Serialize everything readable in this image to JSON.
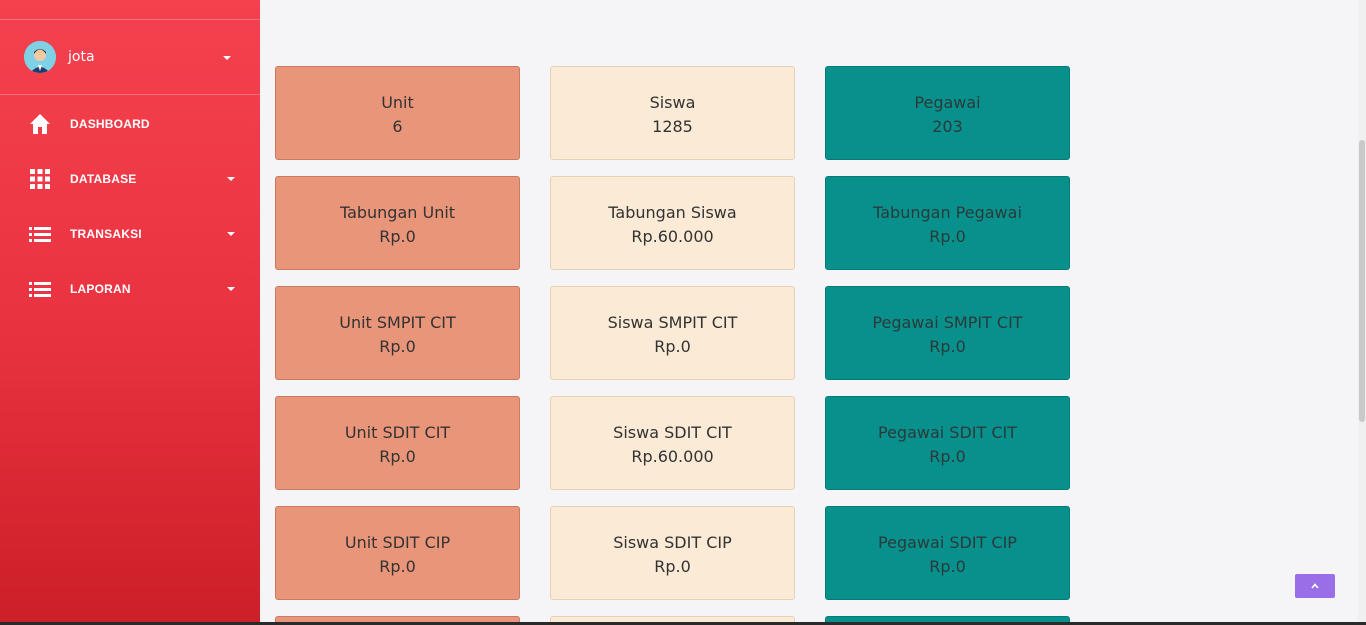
{
  "user": {
    "name": "jota"
  },
  "sidebar": {
    "items": [
      {
        "label": "DASHBOARD",
        "icon": "home-icon"
      },
      {
        "label": "DATABASE",
        "icon": "grid-icon"
      },
      {
        "label": "TRANSAKSI",
        "icon": "list-icon"
      },
      {
        "label": "LAPORAN",
        "icon": "list-icon"
      }
    ]
  },
  "cards": {
    "unit": [
      {
        "label": "Unit",
        "value": "6"
      },
      {
        "label": "Tabungan Unit",
        "value": "Rp.0"
      },
      {
        "label": "Unit SMPIT CIT",
        "value": "Rp.0"
      },
      {
        "label": "Unit SDIT CIT",
        "value": "Rp.0"
      },
      {
        "label": "Unit SDIT CIP",
        "value": "Rp.0"
      }
    ],
    "siswa": [
      {
        "label": "Siswa",
        "value": "1285"
      },
      {
        "label": "Tabungan Siswa",
        "value": "Rp.60.000"
      },
      {
        "label": "Siswa SMPIT CIT",
        "value": "Rp.0"
      },
      {
        "label": "Siswa SDIT CIT",
        "value": "Rp.60.000"
      },
      {
        "label": "Siswa SDIT CIP",
        "value": "Rp.0"
      }
    ],
    "pegawai": [
      {
        "label": "Pegawai",
        "value": "203"
      },
      {
        "label": "Tabungan Pegawai",
        "value": "Rp.0"
      },
      {
        "label": "Pegawai SMPIT CIT",
        "value": "Rp.0"
      },
      {
        "label": "Pegawai SDIT CIT",
        "value": "Rp.0"
      },
      {
        "label": "Pegawai SDIT CIP",
        "value": "Rp.0"
      }
    ]
  },
  "colors": {
    "sidebar_top": "#f5414f",
    "sidebar_bottom": "#cc1f28",
    "unit_card": "#e9957a",
    "siswa_card": "#fbead5",
    "pegawai_card": "#08918c",
    "back_to_top": "#9a6ee6"
  }
}
